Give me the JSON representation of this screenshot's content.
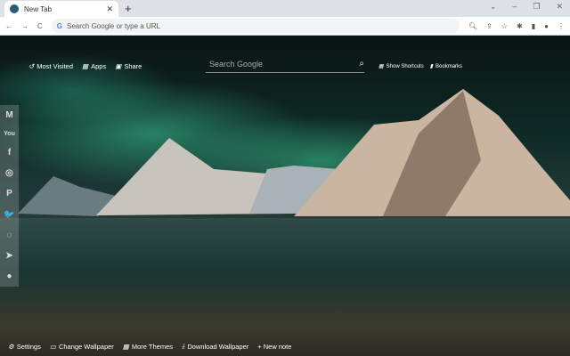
{
  "browser": {
    "tab_title": "New Tab",
    "address_placeholder": "Search Google or type a URL"
  },
  "topnav": {
    "most_visited": "Most Visited",
    "apps": "Apps",
    "share": "Share"
  },
  "search": {
    "placeholder": "Search Google"
  },
  "rightnav": {
    "show_shortcuts": "Show Shortcuts",
    "bookmarks": "Bookmarks"
  },
  "sidebar": [
    {
      "icon": "gmail-icon",
      "glyph": "M"
    },
    {
      "icon": "youtube-icon",
      "glyph": "You"
    },
    {
      "icon": "facebook-icon",
      "glyph": "f"
    },
    {
      "icon": "instagram-icon",
      "glyph": "◎"
    },
    {
      "icon": "pinterest-icon",
      "glyph": "P"
    },
    {
      "icon": "twitter-icon",
      "glyph": "🐦"
    },
    {
      "icon": "whatsapp-icon",
      "glyph": "◌"
    },
    {
      "icon": "telegram-icon",
      "glyph": "➤"
    },
    {
      "icon": "reddit-icon",
      "glyph": "●"
    }
  ],
  "bottom": {
    "settings": "Settings",
    "change_wallpaper": "Change Wallpaper",
    "more_themes": "More Themes",
    "download_wallpaper": "Download Wallpaper",
    "new_note": "+ New note"
  }
}
